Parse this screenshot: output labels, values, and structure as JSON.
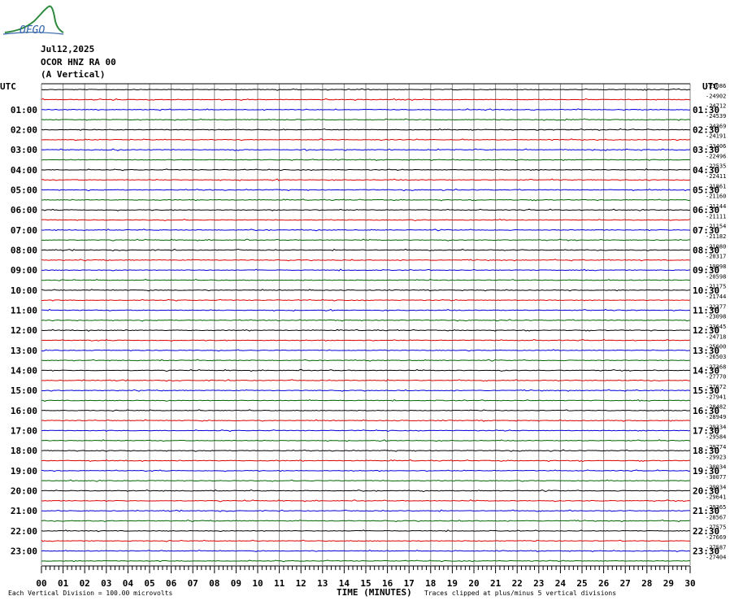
{
  "logo": {
    "name": "OFGO-logo"
  },
  "header": {
    "date": "Jul12,2025",
    "station": "OCOR HNZ RA 00",
    "component": "(A Vertical)"
  },
  "utc_left": "UTC",
  "utc_right": "UTC",
  "footer": {
    "division": "Each Vertical Division =  100.00 microvolts",
    "xlabel": "TIME (MINUTES)",
    "clip_note": "Traces clipped at plus/minus 5 vertical divisions"
  },
  "colors": {
    "trace_cycle": [
      "#000000",
      "#dd0000",
      "#0000dd",
      "#006600"
    ],
    "grid": "#888888"
  },
  "chart_data": {
    "type": "line",
    "subtype": "helicorder",
    "xlabel": "TIME (MINUTES)",
    "xlim": [
      0,
      30
    ],
    "x_ticks": [
      "00",
      "01",
      "02",
      "03",
      "04",
      "05",
      "06",
      "07",
      "08",
      "09",
      "10",
      "11",
      "12",
      "13",
      "14",
      "15",
      "16",
      "17",
      "18",
      "19",
      "20",
      "21",
      "22",
      "23",
      "24",
      "25",
      "26",
      "27",
      "28",
      "29",
      "30"
    ],
    "rows": 48,
    "left_hour_labels": [
      "01:00",
      "02:00",
      "03:00",
      "04:00",
      "05:00",
      "06:00",
      "07:00",
      "08:00",
      "09:00",
      "10:00",
      "11:00",
      "12:00",
      "13:00",
      "14:00",
      "15:00",
      "16:00",
      "17:00",
      "18:00",
      "19:00",
      "20:00",
      "21:00",
      "22:00",
      "23:00"
    ],
    "right_hour_labels": [
      "01:30",
      "02:30",
      "03:30",
      "04:30",
      "05:30",
      "06:30",
      "07:30",
      "08:30",
      "09:30",
      "10:30",
      "11:30",
      "12:30",
      "13:30",
      "14:30",
      "15:30",
      "16:30",
      "17:30",
      "18:30",
      "19:30",
      "20:30",
      "21:30",
      "22:30",
      "23:30"
    ],
    "right_values": [
      "-25086",
      "-24902",
      "-24712",
      "-24539",
      "-24369",
      "-24191",
      "-23406",
      "-22496",
      "-22535",
      "-22411",
      "-21861",
      "-21160",
      "-21144",
      "-21111",
      "-21154",
      "-21182",
      "-21080",
      "-20317",
      "-19998",
      "-20598",
      "-21175",
      "-21744",
      "-22377",
      "-23098",
      "-23645",
      "-24718",
      "-25600",
      "-26503",
      "-27368",
      "-27770",
      "-27672",
      "-27941",
      "-28482",
      "-28949",
      "-29334",
      "-29584",
      "-29774",
      "-29923",
      "-30034",
      "-30077",
      "-29934",
      "-29641",
      "-29365",
      "-28567",
      "-27575",
      "-27669",
      "-27587",
      "-27404"
    ],
    "grid": true
  }
}
